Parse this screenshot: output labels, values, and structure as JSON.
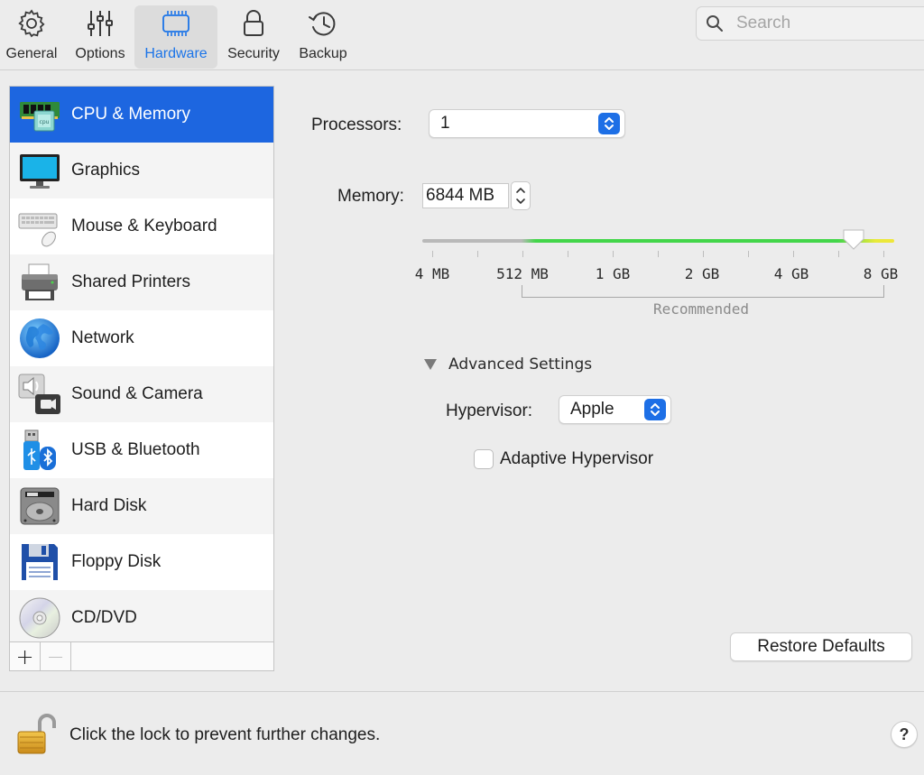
{
  "toolbar": {
    "tabs": [
      {
        "label": "General",
        "icon": "gear-icon"
      },
      {
        "label": "Options",
        "icon": "sliders-icon"
      },
      {
        "label": "Hardware",
        "icon": "chip-icon"
      },
      {
        "label": "Security",
        "icon": "lock-icon"
      },
      {
        "label": "Backup",
        "icon": "history-clock-icon"
      }
    ],
    "active_tab": "Hardware",
    "active_color": "#1b74e8"
  },
  "search": {
    "placeholder": "Search",
    "value": ""
  },
  "sidebar": {
    "items": [
      {
        "label": "CPU & Memory",
        "icon": "cpu-memory-icon",
        "selected": true
      },
      {
        "label": "Graphics",
        "icon": "monitor-icon"
      },
      {
        "label": "Mouse & Keyboard",
        "icon": "keyboard-mouse-icon"
      },
      {
        "label": "Shared Printers",
        "icon": "printer-icon"
      },
      {
        "label": "Network",
        "icon": "globe-icon"
      },
      {
        "label": "Sound & Camera",
        "icon": "speaker-camera-icon"
      },
      {
        "label": "USB & Bluetooth",
        "icon": "usb-bluetooth-icon"
      },
      {
        "label": "Hard Disk",
        "icon": "hard-disk-icon"
      },
      {
        "label": "Floppy Disk",
        "icon": "floppy-disk-icon"
      },
      {
        "label": "CD/DVD",
        "icon": "cd-dvd-icon"
      }
    ],
    "add_label": "+",
    "remove_label": "−",
    "selection_color": "#1d66e0"
  },
  "cpu_memory": {
    "processors_label": "Processors:",
    "processors_value": "1",
    "memory_label": "Memory:",
    "memory_value": "6844 MB",
    "memory_slider": {
      "tick_labels": [
        "4 MB",
        "512 MB",
        "1 GB",
        "2 GB",
        "4 GB",
        "8 GB"
      ],
      "recommended_label": "Recommended",
      "value_mb": 6844
    },
    "advanced": {
      "toggle_label": "Advanced Settings",
      "expanded": true,
      "hypervisor_label": "Hypervisor:",
      "hypervisor_value": "Apple",
      "adaptive_label": "Adaptive Hypervisor",
      "adaptive_checked": false
    },
    "restore_defaults_label": "Restore Defaults"
  },
  "footer": {
    "lock_text": "Click the lock to prevent further changes.",
    "help_label": "?"
  }
}
